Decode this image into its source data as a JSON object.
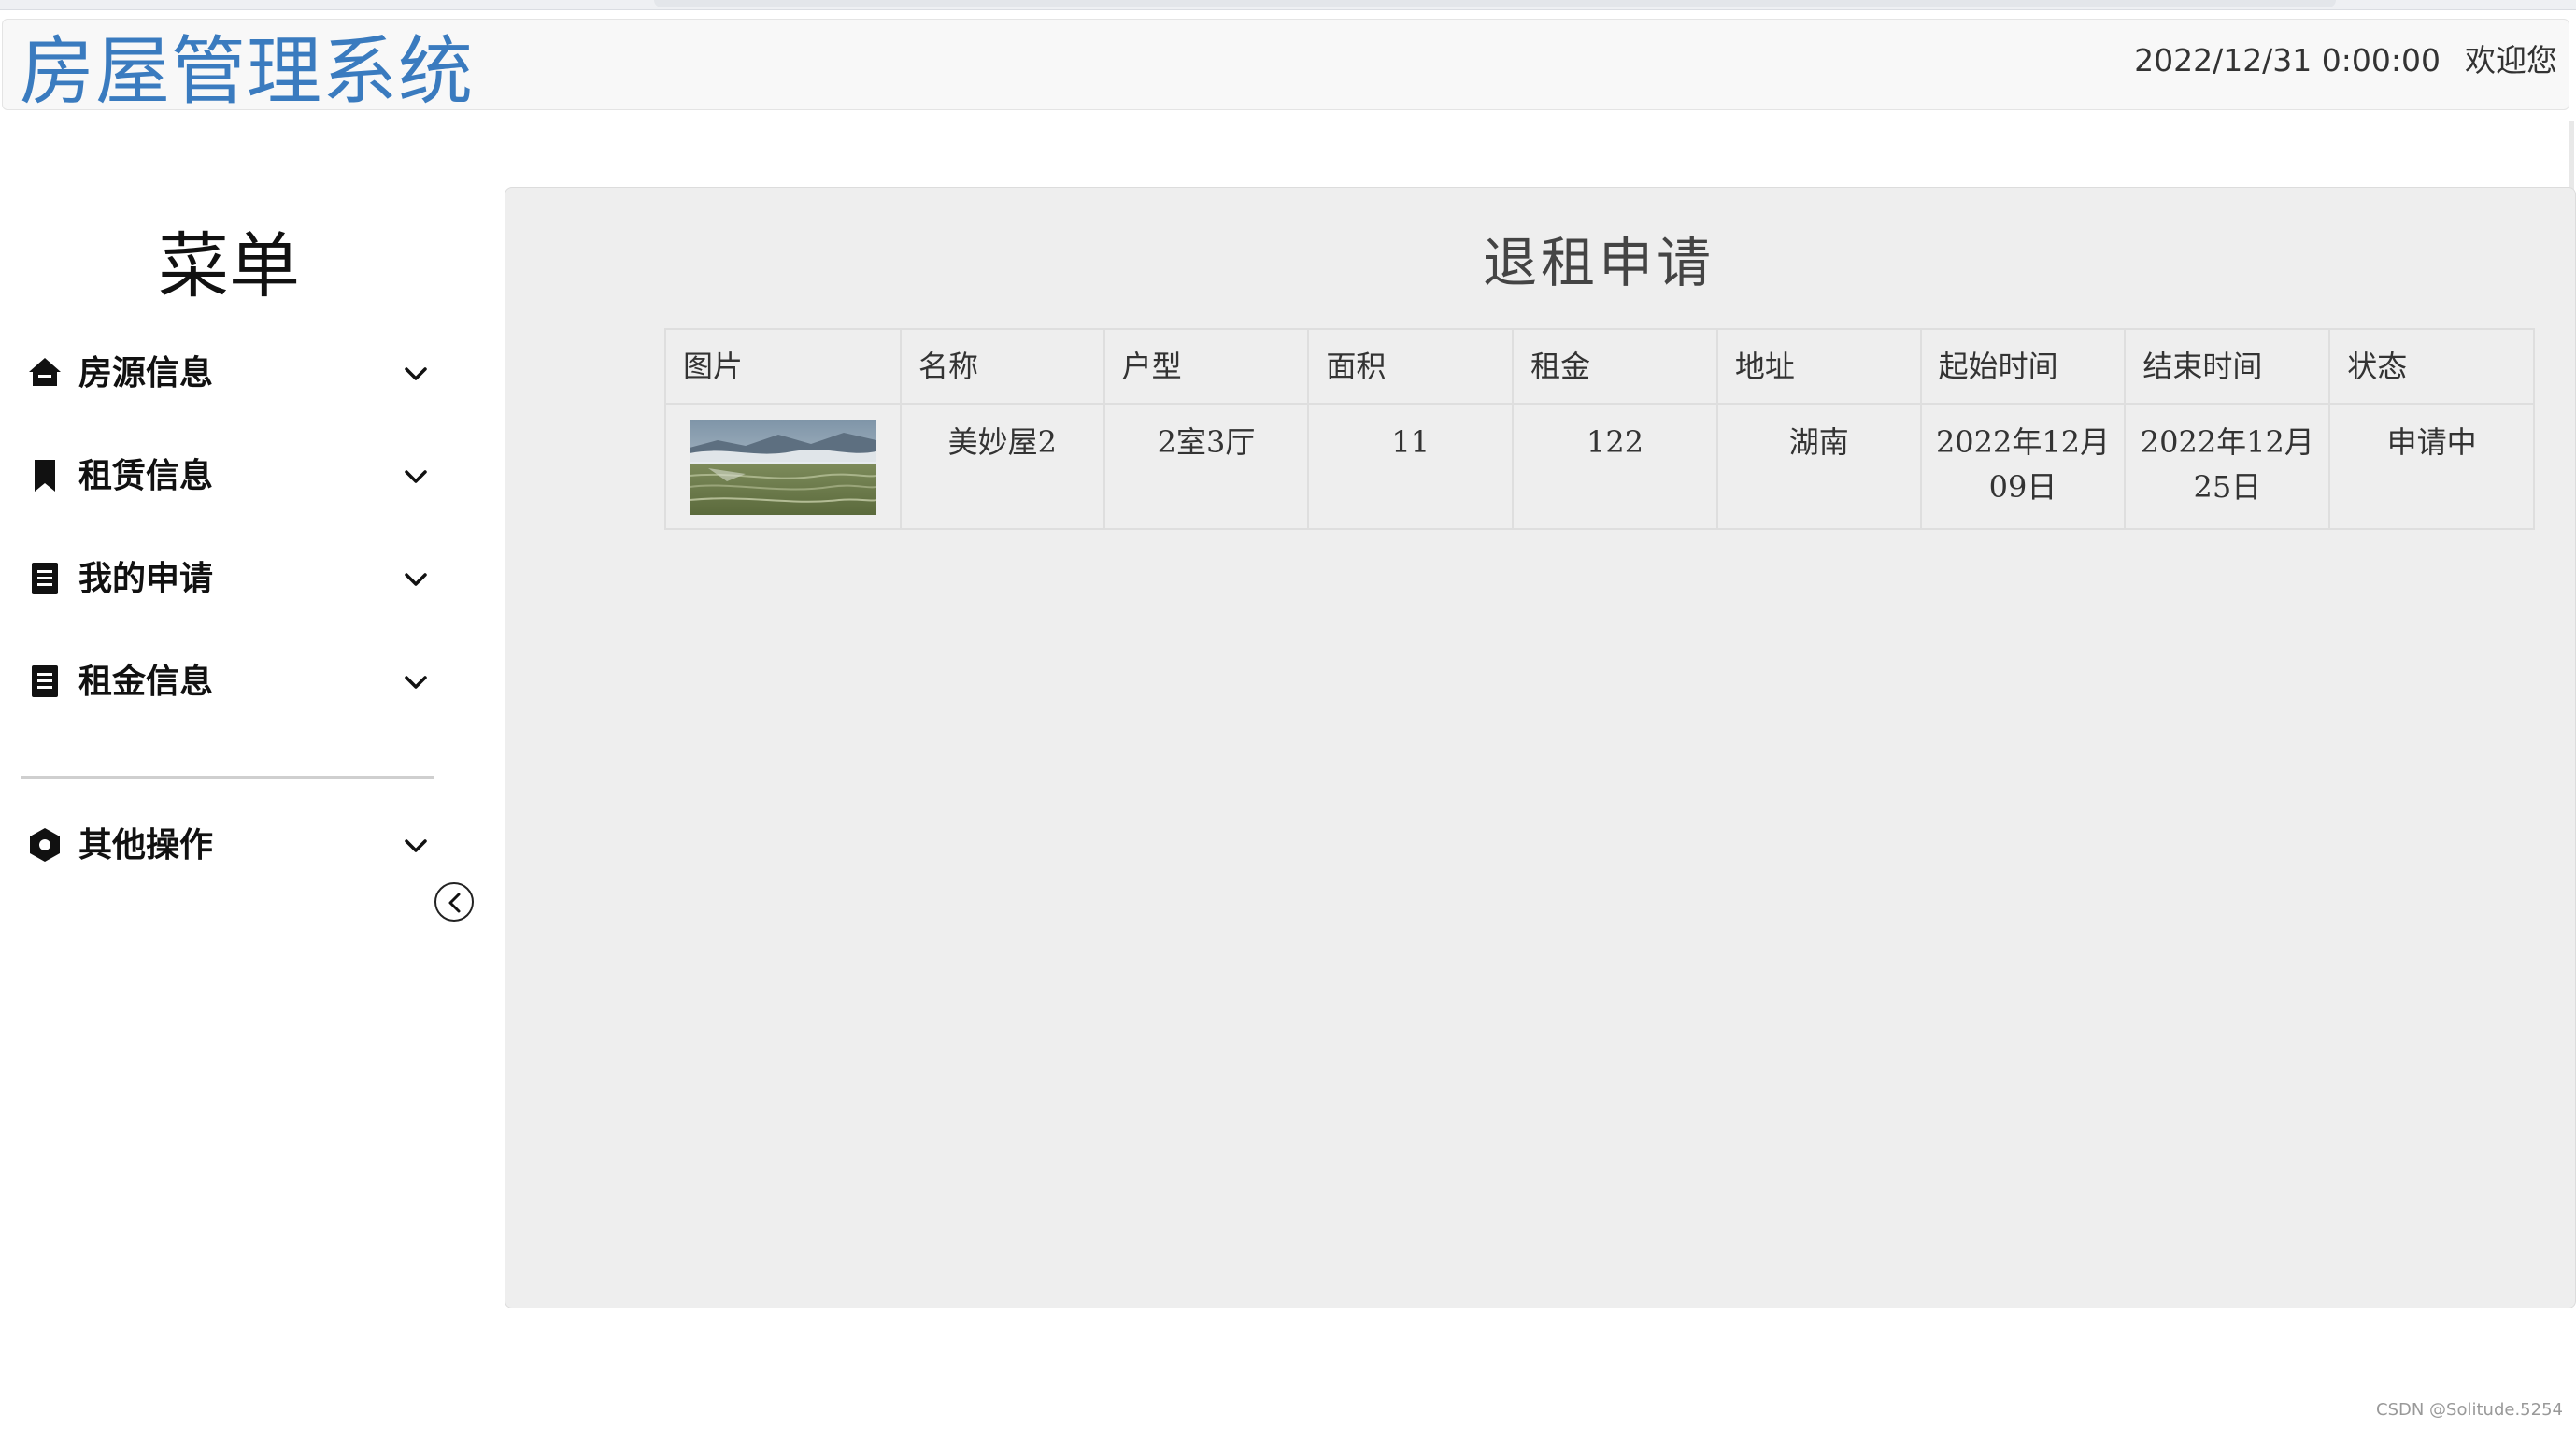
{
  "header": {
    "brand": "房屋管理系统",
    "datetime": "2022/12/31 0:00:00",
    "welcome": "欢迎您"
  },
  "sidebar": {
    "title": "菜单",
    "items": [
      {
        "label": "房源信息",
        "icon": "home-icon"
      },
      {
        "label": "租赁信息",
        "icon": "bookmark-icon"
      },
      {
        "label": "我的申请",
        "icon": "document-icon"
      },
      {
        "label": "租金信息",
        "icon": "document-icon"
      }
    ],
    "other": {
      "label": "其他操作",
      "icon": "hexagon-icon"
    },
    "collapse_icon": "chevron-left-icon"
  },
  "main": {
    "title": "退租申请",
    "table": {
      "headers": [
        "图片",
        "名称",
        "户型",
        "面积",
        "租金",
        "地址",
        "起始时间",
        "结束时间",
        "状态"
      ],
      "rows": [
        {
          "image": "landscape-thumbnail",
          "name": "美妙屋2",
          "layout": "2室3厅",
          "area": "11",
          "rent": "122",
          "address": "湖南",
          "start": "2022年12月09日",
          "end": "2022年12月25日",
          "status": "申请中"
        }
      ]
    }
  },
  "footer": {
    "watermark": "CSDN @Solitude.5254"
  },
  "colors": {
    "brand": "#3a7bbf",
    "content_bg": "#eeeeee",
    "header_bg": "#f8f8f8"
  }
}
